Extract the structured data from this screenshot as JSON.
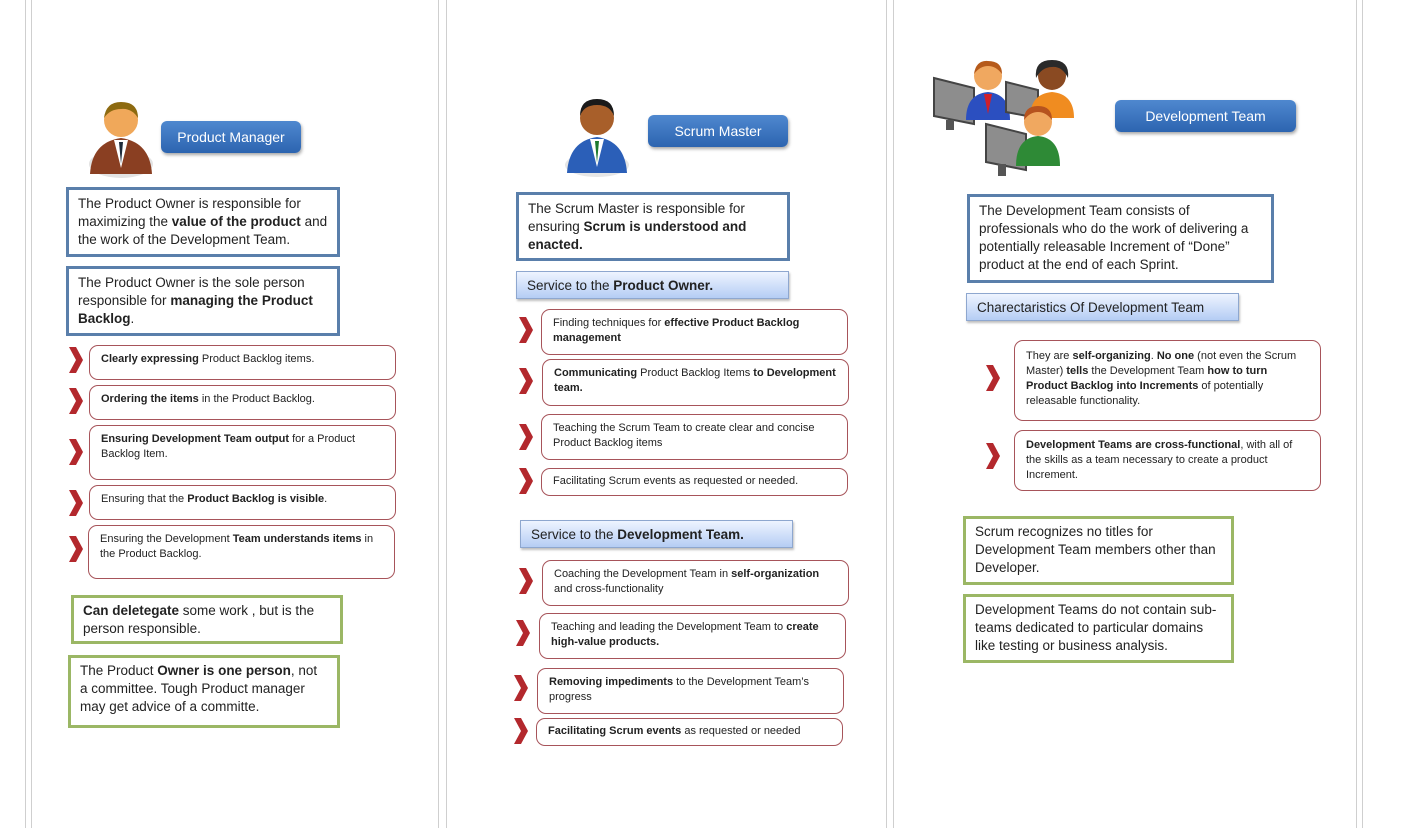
{
  "columns": [
    {
      "title": "Product  Manager",
      "icon": "person-brown-suit-icon",
      "intro_boxes": [
        {
          "parts": [
            {
              "t": "The Product Owner is responsible for maximizing the "
            },
            {
              "t": "value of the product",
              "b": true
            },
            {
              "t": " and the work of the Development Team."
            }
          ]
        },
        {
          "parts": [
            {
              "t": "The Product Owner is the sole person responsible for "
            },
            {
              "t": "managing the Product Backlog",
              "b": true
            },
            {
              "t": "."
            }
          ]
        }
      ],
      "items": [
        {
          "parts": [
            {
              "t": "Clearly expressing",
              "b": true
            },
            {
              "t": " Product Backlog items."
            }
          ]
        },
        {
          "parts": [
            {
              "t": "Ordering the items",
              "b": true
            },
            {
              "t": " in the Product  Backlog."
            }
          ]
        },
        {
          "parts": [
            {
              "t": "Ensuring  Development Team output",
              "b": true
            },
            {
              "t": "  for a Product Backlog Item."
            }
          ]
        },
        {
          "parts": [
            {
              "t": "Ensuring that the "
            },
            {
              "t": "Product Backlog is visible",
              "b": true
            },
            {
              "t": "."
            }
          ]
        },
        {
          "parts": [
            {
              "t": "Ensuring the Development "
            },
            {
              "t": "Team understands  items",
              "b": true
            },
            {
              "t": " in the Product Backlog."
            }
          ]
        }
      ],
      "notes": [
        {
          "parts": [
            {
              "t": "Can deletegate",
              "b": true
            },
            {
              "t": " some work , but is the person responsible."
            }
          ]
        },
        {
          "parts": [
            {
              "t": "The Product "
            },
            {
              "t": "Owner is one person",
              "b": true
            },
            {
              "t": ", not a committee. Tough Product manager may get advice of a committe."
            }
          ]
        }
      ]
    },
    {
      "title": "Scrum Master",
      "icon": "person-blue-suit-icon",
      "intro_boxes": [
        {
          "parts": [
            {
              "t": "The Scrum Master is responsible for ensuring "
            },
            {
              "t": "Scrum is understood and enacted.",
              "b": true
            }
          ]
        }
      ],
      "sections": [
        {
          "header": [
            {
              "t": "Service to the "
            },
            {
              "t": "Product Owner.",
              "b": true
            }
          ],
          "items": [
            {
              "parts": [
                {
                  "t": "Finding techniques  for "
                },
                {
                  "t": "effective Product  Backlog management",
                  "b": true
                }
              ]
            },
            {
              "parts": [
                {
                  "t": "Communicating",
                  "b": true
                },
                {
                  "t": " Product Backlog Items "
                },
                {
                  "t": "to Development team.",
                  "b": true
                }
              ]
            },
            {
              "parts": [
                {
                  "t": "Teaching the Scrum Team to create clear and concise Product Backlog items"
                }
              ]
            },
            {
              "parts": [
                {
                  "t": "Facilitating Scrum events as requested or needed."
                }
              ]
            }
          ]
        },
        {
          "header": [
            {
              "t": "Service to the "
            },
            {
              "t": "Development Team.",
              "b": true
            }
          ],
          "items": [
            {
              "parts": [
                {
                  "t": "Coaching the Development Team in "
                },
                {
                  "t": "self-organization",
                  "b": true
                },
                {
                  "t": " and cross-functionality"
                }
              ]
            },
            {
              "parts": [
                {
                  "t": "Teaching and leading the Development Team to "
                },
                {
                  "t": "create high-value products.",
                  "b": true
                }
              ]
            },
            {
              "parts": [
                {
                  "t": "Removing impediments",
                  "b": true
                },
                {
                  "t": " to the Development Team’s progress"
                }
              ]
            },
            {
              "parts": [
                {
                  "t": "Facilitating Scrum events",
                  "b": true
                },
                {
                  "t": " as requested or needed"
                }
              ]
            }
          ]
        }
      ]
    },
    {
      "title": "Development Team",
      "icon": "team-at-computers-icon",
      "intro_boxes": [
        {
          "parts": [
            {
              "t": "The Development Team consists of professionals who do the work of delivering a potentially releasable Increment of “Done” product at the end of each Sprint."
            }
          ]
        }
      ],
      "section_header": [
        {
          "t": "Charectaristics Of Development Team"
        }
      ],
      "items": [
        {
          "parts": [
            {
              "t": "They are "
            },
            {
              "t": "self-organizing",
              "b": true
            },
            {
              "t": ". "
            },
            {
              "t": "No one",
              "b": true
            },
            {
              "t": " (not even the Scrum Master) "
            },
            {
              "t": "tells",
              "b": true
            },
            {
              "t": " the Development  Team "
            },
            {
              "t": "how to turn Product  Backlog into Increments",
              "b": true
            },
            {
              "t": " of potentially releasable functionality."
            }
          ]
        },
        {
          "parts": [
            {
              "t": "Development Teams are cross-functional",
              "b": true
            },
            {
              "t": ",  with all of the skills as a team necessary to create a product  Increment."
            }
          ]
        }
      ],
      "notes": [
        {
          "parts": [
            {
              "t": "Scrum recognizes no titles for Development Team members other than Developer."
            }
          ]
        },
        {
          "parts": [
            {
              "t": "Development Teams do not contain sub-teams dedicated to particular domains like testing or business analysis."
            }
          ]
        }
      ]
    }
  ],
  "colors": {
    "title_button": "#2f68b3",
    "intro_border": "#5a7fab",
    "note_border": "#9bb765",
    "item_border": "#a7545a",
    "chevron": "#b3282d",
    "section_bar": "#b5cdf4"
  }
}
